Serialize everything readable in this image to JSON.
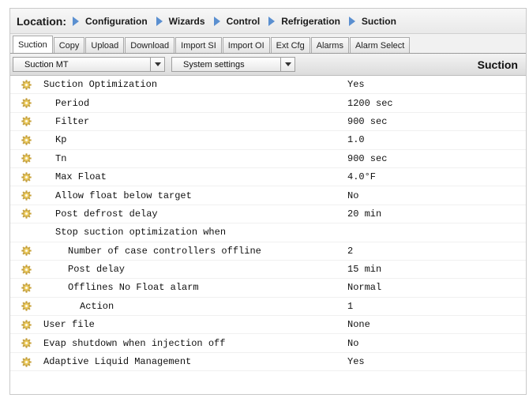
{
  "location": {
    "label": "Location:",
    "breadcrumbs": [
      "Configuration",
      "Wizards",
      "Control",
      "Refrigeration",
      "Suction"
    ]
  },
  "tabs": [
    "Suction",
    "Copy",
    "Upload",
    "Download",
    "Import SI",
    "Import OI",
    "Ext Cfg",
    "Alarms",
    "Alarm Select"
  ],
  "active_tab": "Suction",
  "toolbar": {
    "dropdown1": "Suction MT",
    "dropdown2": "System settings",
    "section_title": "Suction"
  },
  "rows": [
    {
      "label": "Suction Optimization",
      "value": "Yes",
      "indent": 0,
      "icon": "gear-icon"
    },
    {
      "label": "Period",
      "value": "1200 sec",
      "indent": 1,
      "icon": "gear-icon"
    },
    {
      "label": "Filter",
      "value": "900 sec",
      "indent": 1,
      "icon": "gear-icon"
    },
    {
      "label": "Kp",
      "value": "1.0",
      "indent": 1,
      "icon": "gear-icon"
    },
    {
      "label": "Tn",
      "value": "900 sec",
      "indent": 1,
      "icon": "gear-icon"
    },
    {
      "label": "Max Float",
      "value": "4.0°F",
      "indent": 1,
      "icon": "gear-icon"
    },
    {
      "label": "Allow float below target",
      "value": "No",
      "indent": 1,
      "icon": "gear-icon"
    },
    {
      "label": "Post defrost delay",
      "value": "20 min",
      "indent": 1,
      "icon": "gear-icon"
    },
    {
      "label": "Stop suction optimization when",
      "value": "",
      "indent": 1,
      "icon": ""
    },
    {
      "label": "Number of case controllers offline",
      "value": "2",
      "indent": 2,
      "icon": "gear-icon"
    },
    {
      "label": "Post delay",
      "value": "15 min",
      "indent": 2,
      "icon": "gear-icon"
    },
    {
      "label": "Offlines No Float alarm",
      "value": "Normal",
      "indent": 2,
      "icon": "gear-icon"
    },
    {
      "label": "Action",
      "value": "1",
      "indent": 3,
      "icon": "gear-icon"
    },
    {
      "label": "User file",
      "value": "None",
      "indent": 0,
      "icon": "gear-icon"
    },
    {
      "label": "Evap shutdown when injection off",
      "value": "No",
      "indent": 0,
      "icon": "gear-icon"
    },
    {
      "label": "Adaptive Liquid Management",
      "value": "Yes",
      "indent": 0,
      "icon": "gear-icon"
    }
  ]
}
